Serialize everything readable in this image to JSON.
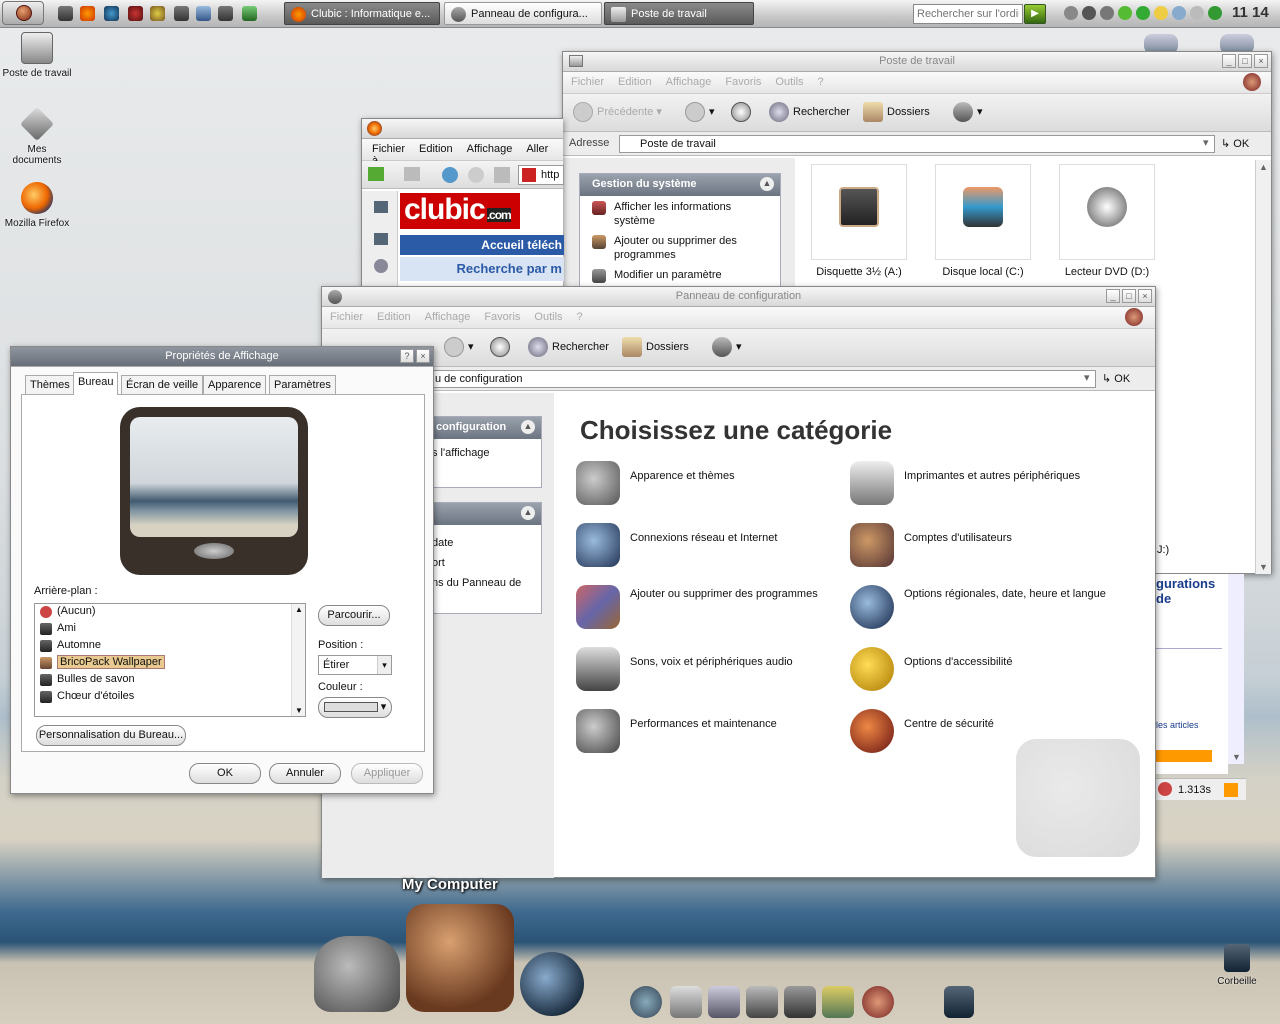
{
  "taskbar": {
    "buttons": [
      {
        "label": "Clubic : Informatique e..."
      },
      {
        "label": "Panneau de configura..."
      },
      {
        "label": "Poste de travail"
      }
    ],
    "search_placeholder": "Rechercher sur l'ordina",
    "clock": "11 14"
  },
  "desktop": {
    "icons": [
      {
        "label": "Poste de travail"
      },
      {
        "label": "Mes documents"
      },
      {
        "label": "Mozilla Firefox"
      }
    ],
    "trash": "Corbeille"
  },
  "mycomputer": {
    "title": "Poste de travail",
    "menu": [
      "Fichier",
      "Edition",
      "Affichage",
      "Favoris",
      "Outils",
      "?"
    ],
    "toolbar": {
      "back": "Précédente",
      "search": "Rechercher",
      "folders": "Dossiers"
    },
    "address_label": "Adresse",
    "address": "Poste de travail",
    "ok": "OK",
    "panel_title": "Gestion du système",
    "panel_items": [
      "Afficher les informations système",
      "Ajouter ou supprimer des programmes",
      "Modifier un paramètre"
    ],
    "drives": [
      "Disquette 3½ (A:)",
      "Disque local (C:)",
      "Lecteur DVD (D:)"
    ],
    "partial": "J:)"
  },
  "browser": {
    "menu": [
      "Fichier",
      "Edition",
      "Affichage",
      "Aller à"
    ],
    "url": "http",
    "logo": "clubic",
    "logo_sub": ".com",
    "band1": "Accueil téléch",
    "band2": "Recherche par m",
    "right_heading_1": "gurations",
    "right_heading_2": "de",
    "link": "les articles",
    "status_time": "1.313s"
  },
  "controlpanel": {
    "title": "Panneau de configuration",
    "menu": [
      "Fichier",
      "Edition",
      "Affichage",
      "Favoris",
      "Outils",
      "?"
    ],
    "toolbar": {
      "search": "Rechercher",
      "folders": "Dossiers"
    },
    "address": "u de configuration",
    "ok": "OK",
    "side1_title": "configuration",
    "side1_item": "s l'affichage",
    "side2_items": [
      "date",
      "ort",
      "ns du Panneau de"
    ],
    "heading": "Choisissez une catégorie",
    "categories": [
      "Apparence et thèmes",
      "Imprimantes et autres périphériques",
      "Connexions réseau et Internet",
      "Comptes d'utilisateurs",
      "Ajouter ou supprimer des programmes",
      "Options régionales, date, heure et langue",
      "Sons, voix et périphériques audio",
      "Options d'accessibilité",
      "Performances et maintenance",
      "Centre de sécurité"
    ]
  },
  "dialog": {
    "title": "Propriétés de Affichage",
    "tabs": [
      "Thèmes",
      "Bureau",
      "Écran de veille",
      "Apparence",
      "Paramètres"
    ],
    "background_label": "Arrière-plan :",
    "backgrounds": [
      "(Aucun)",
      "Ami",
      "Automne",
      "BricoPack Wallpaper",
      "Bulles de savon",
      "Chœur d'étoiles"
    ],
    "selected_background": "BricoPack Wallpaper",
    "browse": "Parcourir...",
    "position_label": "Position :",
    "position_value": "Étirer",
    "color_label": "Couleur :",
    "customize": "Personnalisation du Bureau...",
    "ok": "OK",
    "cancel": "Annuler",
    "apply": "Appliquer"
  },
  "dock": {
    "label": "My Computer"
  }
}
